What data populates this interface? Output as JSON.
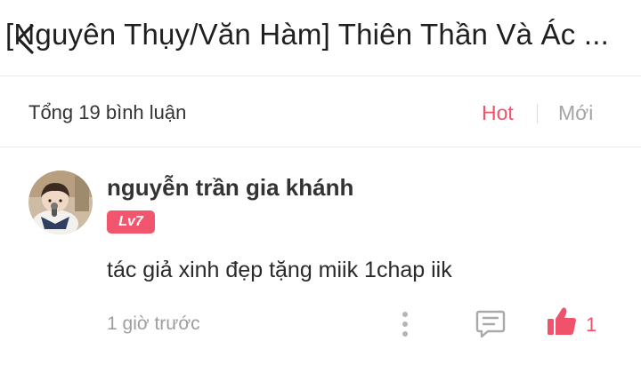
{
  "header": {
    "title": "[Nguyên Thụy/Văn Hàm] Thiên Thần Và Ác ...",
    "back_icon": "chevron-left-icon"
  },
  "summary": {
    "count_label": "Tổng 19 bình luận",
    "sort_hot": "Hot",
    "sort_new": "Mới"
  },
  "comment": {
    "username": "nguyễn trần gia khánh",
    "level": "Lv7",
    "text": "tác giả xinh đẹp tặng miik 1chap iik",
    "time": "1 giờ trước",
    "like_count": "1",
    "icons": [
      "more-vertical-icon",
      "reply-icon",
      "thumbs-up-icon"
    ]
  },
  "colors": {
    "accent": "#f0516b",
    "badge": "#f2566f",
    "muted": "#9e9e9e"
  }
}
